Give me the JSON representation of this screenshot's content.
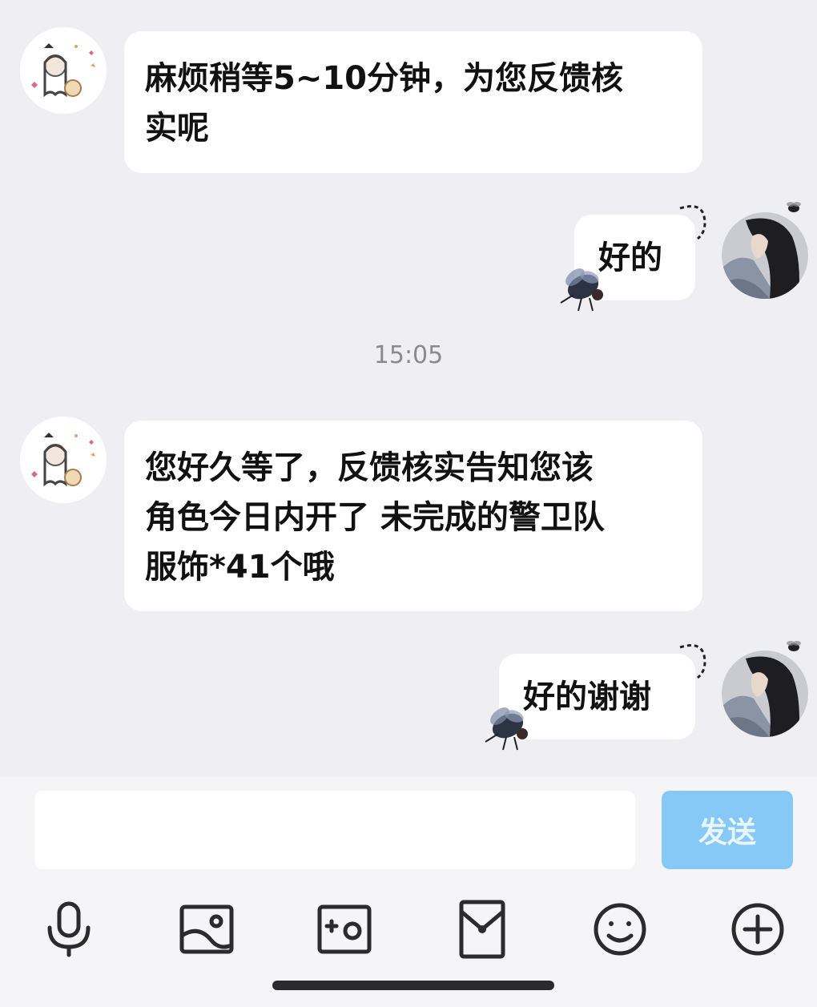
{
  "messages": [
    {
      "from": "agent",
      "text_lines": [
        "麻烦稍等5~10分钟，为您反馈核",
        "实呢"
      ]
    },
    {
      "from": "user",
      "text_lines": [
        "好的"
      ]
    },
    {
      "from": "agent",
      "text_lines": [
        "您好久等了，反馈核实告知您该",
        "角色今日内开了 未完成的警卫队",
        "服饰*41个哦"
      ]
    },
    {
      "from": "user",
      "text_lines": [
        "好的谢谢"
      ]
    }
  ],
  "timestamp": "15:05",
  "composer": {
    "placeholder": "",
    "send_label": "发送"
  },
  "toolbar": {
    "icons": [
      "microphone-icon",
      "image-icon",
      "camera-icon",
      "red-packet-icon",
      "emoji-icon",
      "plus-icon"
    ]
  },
  "colors": {
    "background": "#eeeef3",
    "bubble": "#ffffff",
    "send_button": "#86c9f6",
    "icon": "#2b2b2b",
    "timestamp": "#8a8a8e"
  }
}
